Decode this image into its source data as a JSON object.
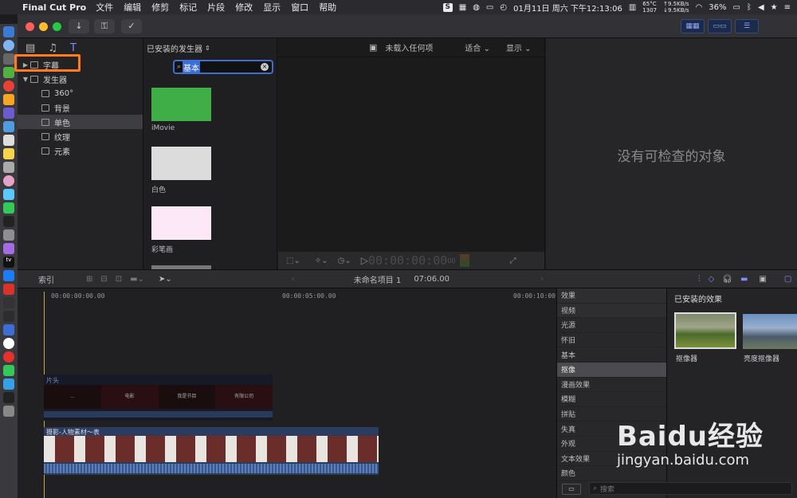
{
  "menubar": {
    "app_name": "Final Cut Pro",
    "items": [
      "文件",
      "编辑",
      "修剪",
      "标记",
      "片段",
      "修改",
      "显示",
      "窗口",
      "帮助"
    ],
    "status": {
      "datetime": "01月11日 周六 下午12:13:06",
      "temp": "65°C",
      "fan": "1307",
      "net_up": "↑9.5KB/s",
      "net_down": "↓9.5KB/s",
      "battery": "36%"
    }
  },
  "sidebar": {
    "items": [
      {
        "label": "字幕",
        "level": 0,
        "expanded": false
      },
      {
        "label": "发生器",
        "level": 0,
        "expanded": true
      },
      {
        "label": "360°",
        "level": 1
      },
      {
        "label": "背景",
        "level": 1
      },
      {
        "label": "单色",
        "level": 1,
        "selected": true
      },
      {
        "label": "纹理",
        "level": 1
      },
      {
        "label": "元素",
        "level": 1
      }
    ]
  },
  "generators": {
    "header": "已安装的发生器",
    "search_value": "基本",
    "items": [
      {
        "label": "iMovie",
        "color": "#3fae46"
      },
      {
        "label": "白色",
        "color": "#dcdcdc"
      },
      {
        "label": "彩笔画",
        "color": "#fde8f8"
      }
    ]
  },
  "viewer": {
    "title": "未载入任何项",
    "fit": "适合",
    "display": "显示",
    "timecode": "00:00:00:00",
    "timecode_suffix": "00"
  },
  "inspector": {
    "message": "没有可检查的对象"
  },
  "timeline_bar": {
    "index_label": "索引",
    "project_name": "未命名项目 1",
    "duration": "07:06.00"
  },
  "timeline": {
    "ruler": [
      "00:00:00:00.00",
      "00:00:05:00.00",
      "00:00:10:00.00"
    ],
    "title_clip": "片头",
    "title_clip_frames": [
      "...",
      "电影",
      "我是节目",
      "有限公司"
    ],
    "main_clip": "摄影-人物素材～表"
  },
  "effects": {
    "header": "效果",
    "installed_header": "已安装的效果",
    "categories": [
      "视频",
      "光源",
      "怀旧",
      "基本",
      "抠像",
      "漫画效果",
      "模糊",
      "拼贴",
      "失真",
      "外观",
      "文本效果",
      "颜色"
    ],
    "selected": "抠像",
    "items": [
      "抠像器",
      "亮度抠像器"
    ],
    "search_placeholder": "搜索"
  },
  "watermark": {
    "brand": "Baidu经验",
    "url": "jingyan.baidu.com"
  }
}
